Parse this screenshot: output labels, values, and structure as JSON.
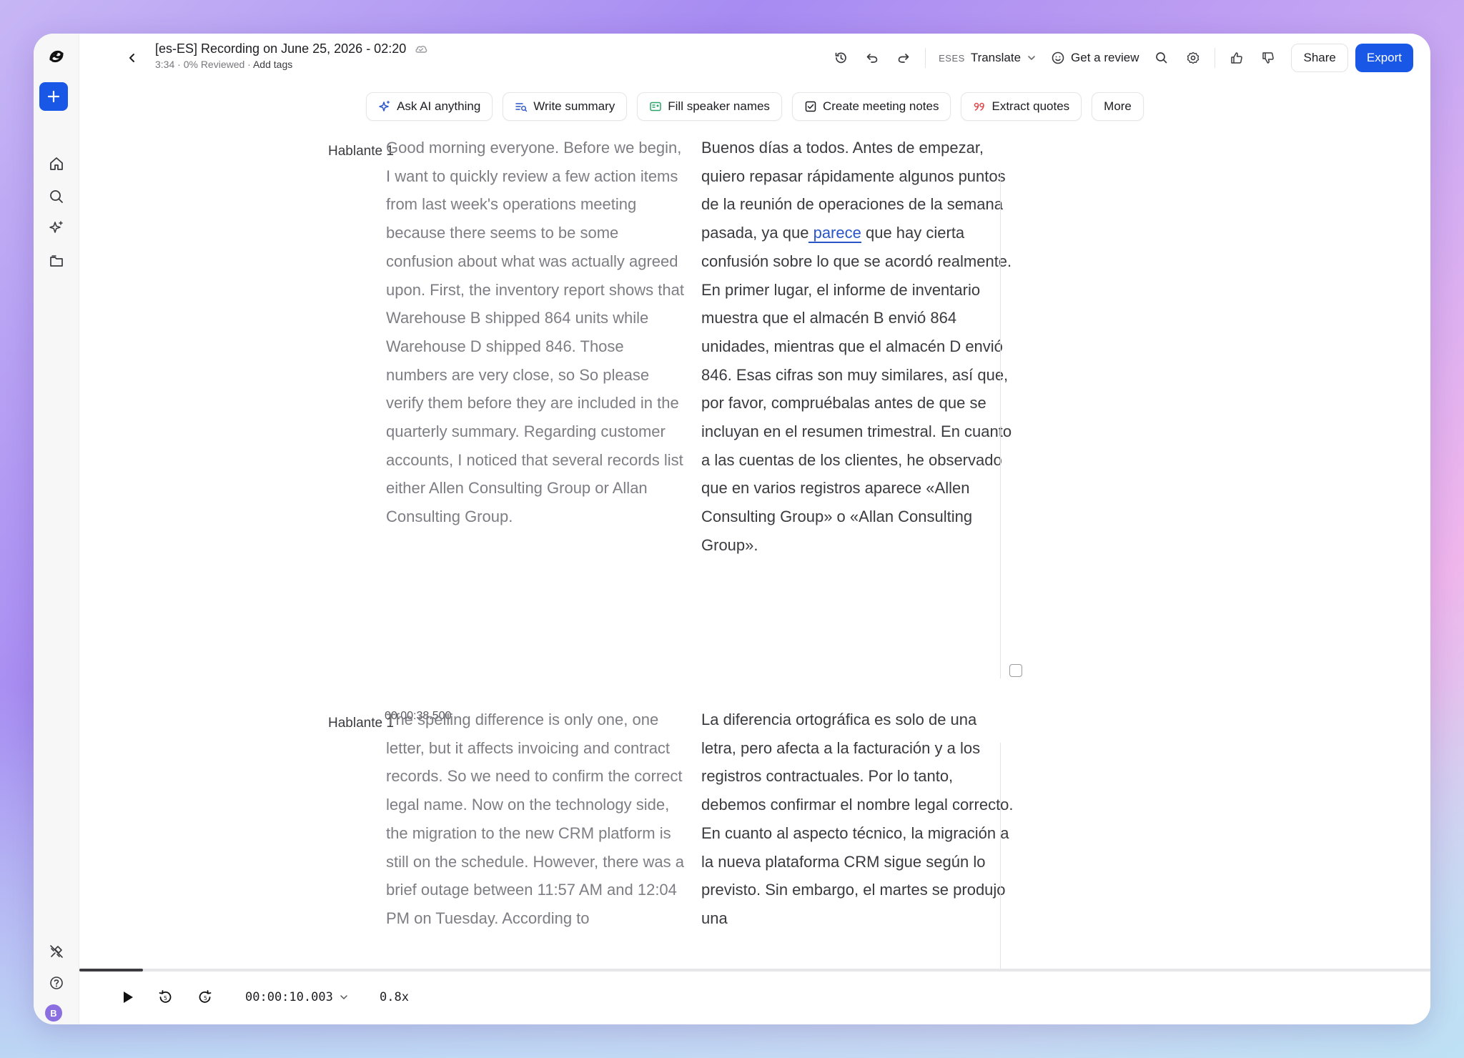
{
  "header": {
    "title": "[es-ES] Recording on June 25, 2026 - 02:20",
    "subtitle_meta": "3:34 · 0% Reviewed ·",
    "add_tags": "Add tags",
    "translate_code": "ESES",
    "translate_label": "Translate",
    "review_label": "Get a review",
    "share_label": "Share",
    "export_label": "Export"
  },
  "ai_toolbar": {
    "ask": "Ask AI anything",
    "summary": "Write summary",
    "speakers": "Fill speaker names",
    "notes": "Create meeting notes",
    "quotes": "Extract quotes",
    "more": "More"
  },
  "segments": [
    {
      "speaker": "Hablante 1",
      "original": "Good morning everyone. Before we begin, I want to quickly review a few action items from last week's operations meeting because there seems to be some confusion about what was actually agreed upon. First, the inventory report shows that Warehouse B shipped 864 units while Warehouse D shipped 846. Those numbers are very close, so So please verify them before they are included in the quarterly summary. Regarding customer accounts, I noticed that several records list either Allen Consulting Group or Allan Consulting Group.",
      "translation_before": "Buenos días a todos. Antes de empezar, quiero repasar rápidamente algunos puntos de la reunión de operaciones de la semana pasada, ya que",
      "translation_highlight": " parece",
      "translation_after": " que hay cierta confusión sobre lo que se acordó realmente. En primer lugar, el informe de inventario muestra que el almacén B envió 864 unidades, mientras que el almacén D envió 846. Esas cifras son muy similares, así que, por favor, compruébalas antes de que se incluyan en el resumen trimestral. En cuanto a las cuentas de los clientes, he observado que en varios registros aparece «Allen Consulting Group» o «Allan Consulting Group»."
    },
    {
      "timestamp": "00:00:38.500",
      "speaker": "Hablante 1",
      "original": "The spelling difference is only one, one letter, but it affects invoicing and contract records. So we need to confirm the correct legal name. Now on the technology side, the migration to the new CRM platform is still on the schedule. However, there was a brief outage between 11:57 AM and 12:04 PM on Tuesday. According to",
      "translation": "La diferencia ortográfica es solo de una letra, pero afecta a la facturación y a los registros contractuales. Por lo tanto, debemos confirmar el nombre legal correcto. En cuanto al aspecto técnico, la migración a la nueva plataforma CRM sigue según lo previsto. Sin embargo, el martes se produjo una"
    }
  ],
  "player": {
    "time": "00:00:10.003",
    "speed": "0.8x",
    "progress": 0.047
  },
  "user": {
    "initial": "B"
  },
  "colors": {
    "accent": "#1957e6",
    "highlight": "#2a55c9"
  }
}
